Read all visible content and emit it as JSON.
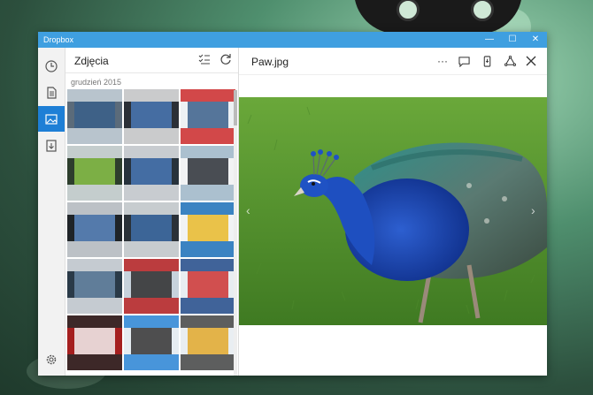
{
  "window": {
    "title": "Dropbox",
    "minimize": "—",
    "maximize": "☐",
    "close": "✕"
  },
  "nav": {
    "items": [
      "recent-icon",
      "files-icon",
      "photos-icon",
      "offline-icon"
    ],
    "settings": "gear-icon"
  },
  "list": {
    "title": "Zdjęcia",
    "section": "grudzień 2015",
    "thumb_colors": [
      [
        "#5b6b7a",
        "#c9d3dc",
        "#3a5f8a"
      ],
      [
        "#2b2f36",
        "#e6e6e6",
        "#4a78b5"
      ],
      [
        "#edf1f4",
        "#cc2a2a",
        "#3a5f8a"
      ],
      [
        "#2d3e2d",
        "#dfe6ea",
        "#8bc34a"
      ],
      [
        "#27323c",
        "#e5e8ea",
        "#4a78b5"
      ],
      [
        "#f2f3f4",
        "#9fb6c8",
        "#2b2f36"
      ],
      [
        "#1f2428",
        "#d8dde2",
        "#5e89c2"
      ],
      [
        "#2a3138",
        "#e3e7ea",
        "#3f6ea8"
      ],
      [
        "#f1f3f5",
        "#1b6fb8",
        "#e9b82a"
      ],
      [
        "#2a3a48",
        "#e0e5ea",
        "#6a89a8"
      ],
      [
        "#c7d2dc",
        "#b92222",
        "#2d2d2d"
      ],
      [
        "#e8edf1",
        "#224a8a",
        "#c33"
      ],
      [
        "#a51f1f",
        "#2a2a2a",
        "#f2f2f2"
      ],
      [
        "#e6ecf1",
        "#2b86d6",
        "#333"
      ],
      [
        "#e9eef2",
        "#444",
        "#e2a82b"
      ]
    ]
  },
  "viewer": {
    "filename": "Paw.jpg",
    "more": "···"
  },
  "colors": {
    "accent": "#1e7fd6",
    "titlebar": "#3f9fe0"
  }
}
